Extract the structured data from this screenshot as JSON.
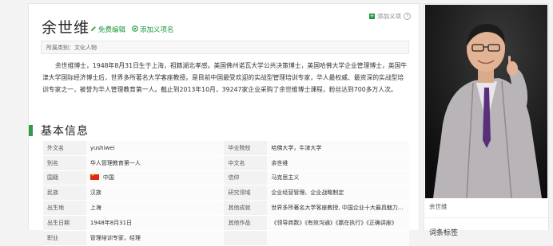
{
  "page": {
    "title": "余世维",
    "edit_label": "免费编辑",
    "add_sense_label": "添加义项名",
    "add_tag_label": "添加义项",
    "help_icon": "?",
    "category_label": "所属类别：文化人物",
    "intro": "余世维博士，1948年8月31日生于上海，祖籍湖北孝感。美国佛州诺瓦大学公共决策博士，美国哈佛大学企业管理博士，英国牛津大学国际经济博士后，世界多所著名大学客座教授。是目前中国最受欢迎的实战型管理培训专家，华人最权威、最资深的实战型培训专家之一，被誉为华人管理教育第一人。截止到2013年10月，39247家企业采购了余世维博士课程，粉丝达到700多万人次。",
    "section_title": "基本信息"
  },
  "info": [
    {
      "k1": "外文名",
      "v1": "yushiwei",
      "k2": "毕业院校",
      "v2": "哈佛大学，牛津大学"
    },
    {
      "k1": "别名",
      "v1": "华人管理教育第一人",
      "k2": "中文名",
      "v2": "余世维"
    },
    {
      "k1": "国籍",
      "v1": "中国",
      "k2": "信仰",
      "v2": "马克思主义"
    },
    {
      "k1": "民族",
      "v1": "汉族",
      "k2": "研究领域",
      "v2": "企业经营管理、企业战略制定"
    },
    {
      "k1": "出生地",
      "v1": "上海",
      "k2": "其他成就",
      "v2": "世界多所著名大学客座教授, 中国企业十大最具魅力..."
    },
    {
      "k1": "出生日期",
      "v1": "1948年8月31日",
      "k2": "其他作品",
      "v2": "《领导商数》《有效沟通》《赢在执行》《正确讲座》"
    },
    {
      "k1": "职业",
      "v1": "管理培训专家，经理",
      "k2": "",
      "v2": ""
    }
  ],
  "sidebar": {
    "photo_caption": "余世维",
    "next_heading": "词条标签"
  },
  "colors": {
    "accent": "#1b9b3e",
    "section_bar": "#2f9a47",
    "flag_red": "#de2910"
  },
  "icons": {
    "edit": "pencil-icon",
    "add_sense": "sense-icon",
    "add_tag": "plus-icon",
    "flag": "china-flag-icon"
  }
}
